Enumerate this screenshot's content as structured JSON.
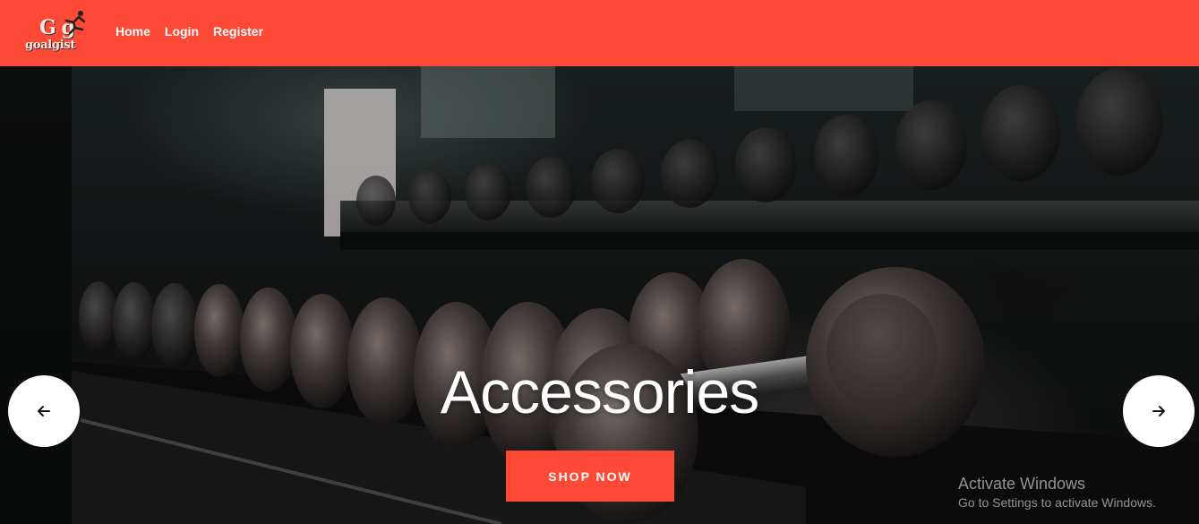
{
  "brand": {
    "logo_mark": "G g",
    "logo_text": "goalgist"
  },
  "nav": {
    "items": [
      {
        "label": "Home"
      },
      {
        "label": "Login"
      },
      {
        "label": "Register"
      }
    ]
  },
  "hero": {
    "title": "Accessories",
    "cta_label": "SHOP NOW",
    "prev_icon": "arrow-left-icon",
    "next_icon": "arrow-right-icon"
  },
  "watermark": {
    "title": "Activate Windows",
    "subtitle": "Go to Settings to activate Windows."
  },
  "colors": {
    "accent": "#fd4936",
    "nav_text": "#ffffff",
    "button_bg": "#ffffff"
  }
}
